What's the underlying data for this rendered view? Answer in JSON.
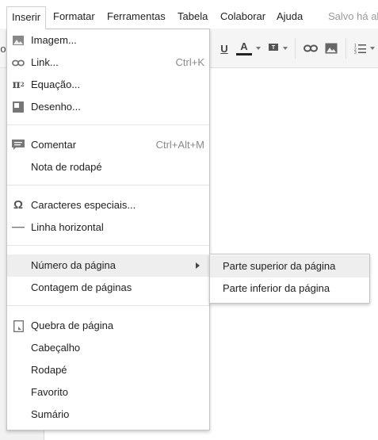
{
  "menubar": {
    "items": [
      "Inserir",
      "Formatar",
      "Ferramentas",
      "Tabela",
      "Colaborar",
      "Ajuda"
    ],
    "saved_status": "Salvo há al"
  },
  "toolbar": {
    "left_fragment": "o",
    "icons": [
      "underline-icon",
      "text-color-icon",
      "highlight-color-icon",
      "link-icon",
      "image-icon",
      "numbered-list-icon"
    ],
    "underline_glyph": "U",
    "text_color_glyph": "A",
    "text_color": "#222222"
  },
  "insert_menu": {
    "items": [
      {
        "label": "Imagem...",
        "icon": "image-icon",
        "shortcut": ""
      },
      {
        "label": "Link...",
        "icon": "link-icon",
        "shortcut": "Ctrl+K"
      },
      {
        "label": "Equação...",
        "icon": "pi-equation-icon",
        "shortcut": ""
      },
      {
        "label": "Desenho...",
        "icon": "drawing-icon",
        "shortcut": ""
      },
      {
        "label": "Comentar",
        "icon": "comment-icon",
        "shortcut": "Ctrl+Alt+M"
      },
      {
        "label": "Nota de rodapé",
        "icon": "",
        "shortcut": ""
      },
      {
        "label": "Caracteres especiais...",
        "icon": "omega-icon",
        "shortcut": ""
      },
      {
        "label": "Linha horizontal",
        "icon": "horizontal-line-icon",
        "shortcut": ""
      },
      {
        "label": "Número da página",
        "icon": "",
        "shortcut": "",
        "has_submenu": true,
        "highlighted": true
      },
      {
        "label": "Contagem de páginas",
        "icon": "",
        "shortcut": ""
      },
      {
        "label": "Quebra de página",
        "icon": "page-break-icon",
        "shortcut": ""
      },
      {
        "label": "Cabeçalho",
        "icon": "",
        "shortcut": ""
      },
      {
        "label": "Rodapé",
        "icon": "",
        "shortcut": ""
      },
      {
        "label": "Favorito",
        "icon": "",
        "shortcut": ""
      },
      {
        "label": "Sumário",
        "icon": "",
        "shortcut": ""
      }
    ],
    "equation_superscript": "2"
  },
  "page_number_submenu": {
    "items": [
      {
        "label": "Parte superior da página",
        "highlighted": true
      },
      {
        "label": "Parte inferior da página",
        "highlighted": false
      }
    ]
  },
  "colors": {
    "menu_highlight": "#eeeeee",
    "toolbar_bg": "#f5f5f5",
    "icon_gray": "#777777"
  }
}
